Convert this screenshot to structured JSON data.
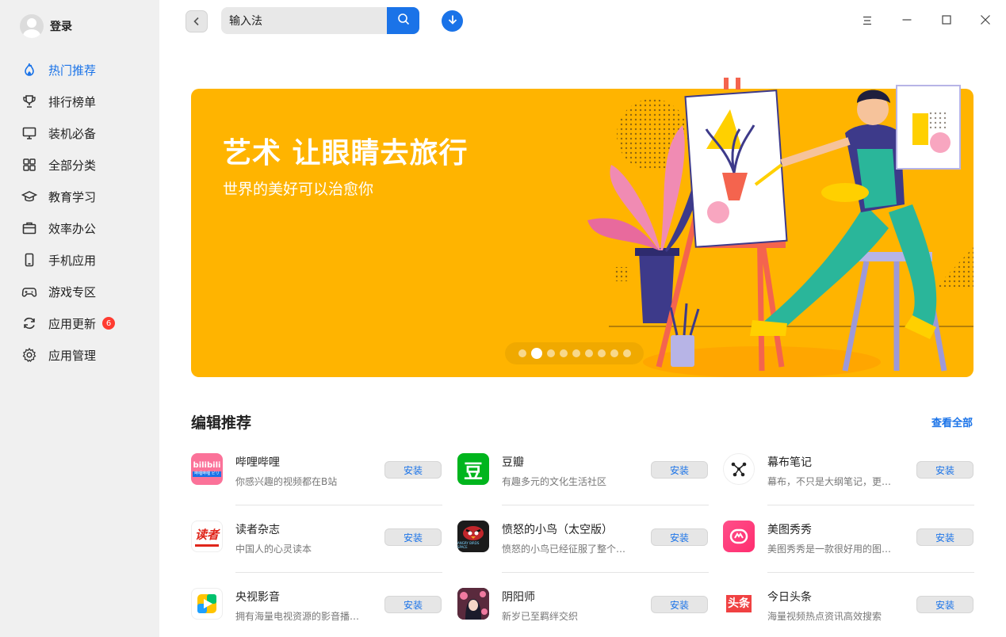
{
  "user": {
    "login_label": "登录"
  },
  "sidebar": {
    "items": [
      {
        "label": "热门推荐",
        "icon": "fire-icon",
        "active": true
      },
      {
        "label": "排行榜单",
        "icon": "trophy-icon"
      },
      {
        "label": "装机必备",
        "icon": "monitor-icon"
      },
      {
        "label": "全部分类",
        "icon": "grid-icon"
      },
      {
        "label": "教育学习",
        "icon": "graduation-cap-icon"
      },
      {
        "label": "效率办公",
        "icon": "briefcase-icon"
      },
      {
        "label": "手机应用",
        "icon": "phone-icon"
      },
      {
        "label": "游戏专区",
        "icon": "gamepad-icon"
      },
      {
        "label": "应用更新",
        "icon": "refresh-icon",
        "badge": "6"
      },
      {
        "label": "应用管理",
        "icon": "settings-icon"
      }
    ]
  },
  "search": {
    "value": "输入法"
  },
  "banner": {
    "title": "艺术 让眼睛去旅行",
    "subtitle": "世界的美好可以治愈你",
    "slide_count": 9,
    "active_slide": 2
  },
  "section": {
    "title": "编辑推荐",
    "view_all": "查看全部"
  },
  "apps": [
    {
      "name": "哔哩哔哩",
      "desc": "你感兴趣的视频都在B站",
      "icon": "bilibili-icon",
      "install": "安装"
    },
    {
      "name": "豆瓣",
      "desc": "有趣多元的文化生活社区",
      "icon": "douban-icon",
      "install": "安装"
    },
    {
      "name": "幕布笔记",
      "desc": "幕布，不只是大纲笔记，更…",
      "icon": "mubu-icon",
      "install": "安装"
    },
    {
      "name": "读者杂志",
      "desc": "中国人的心灵读本",
      "icon": "duzhe-icon",
      "install": "安装"
    },
    {
      "name": "愤怒的小鸟（太空版）",
      "desc": "愤怒的小鸟已经征服了整个…",
      "icon": "angry-birds-icon",
      "install": "安装"
    },
    {
      "name": "美图秀秀",
      "desc": "美图秀秀是一款很好用的图…",
      "icon": "meitu-icon",
      "install": "安装"
    },
    {
      "name": "央视影音",
      "desc": "拥有海量电视资源的影音播…",
      "icon": "cctv-icon",
      "install": "安装"
    },
    {
      "name": "阴阳师",
      "desc": "新岁已至羁绊交织",
      "icon": "onmyoji-icon",
      "install": "安装"
    },
    {
      "name": "今日头条",
      "desc": "海量视频热点资讯高效搜索",
      "icon": "toutiao-icon",
      "install": "安装"
    }
  ],
  "icon_texts": {
    "bilibili": "bilibili",
    "bilibili_sub": "哔哩哔哩 ビリ",
    "douban": "豆",
    "duzhe": "读者",
    "toutiao": "头条",
    "angry_birds_sub": "ANGRY BIRDS SPACE"
  },
  "colors": {
    "accent": "#1a73e8",
    "banner_bg": "#ffb400",
    "badge": "#ff3b30",
    "sidebar_bg": "#f0f0f0"
  }
}
